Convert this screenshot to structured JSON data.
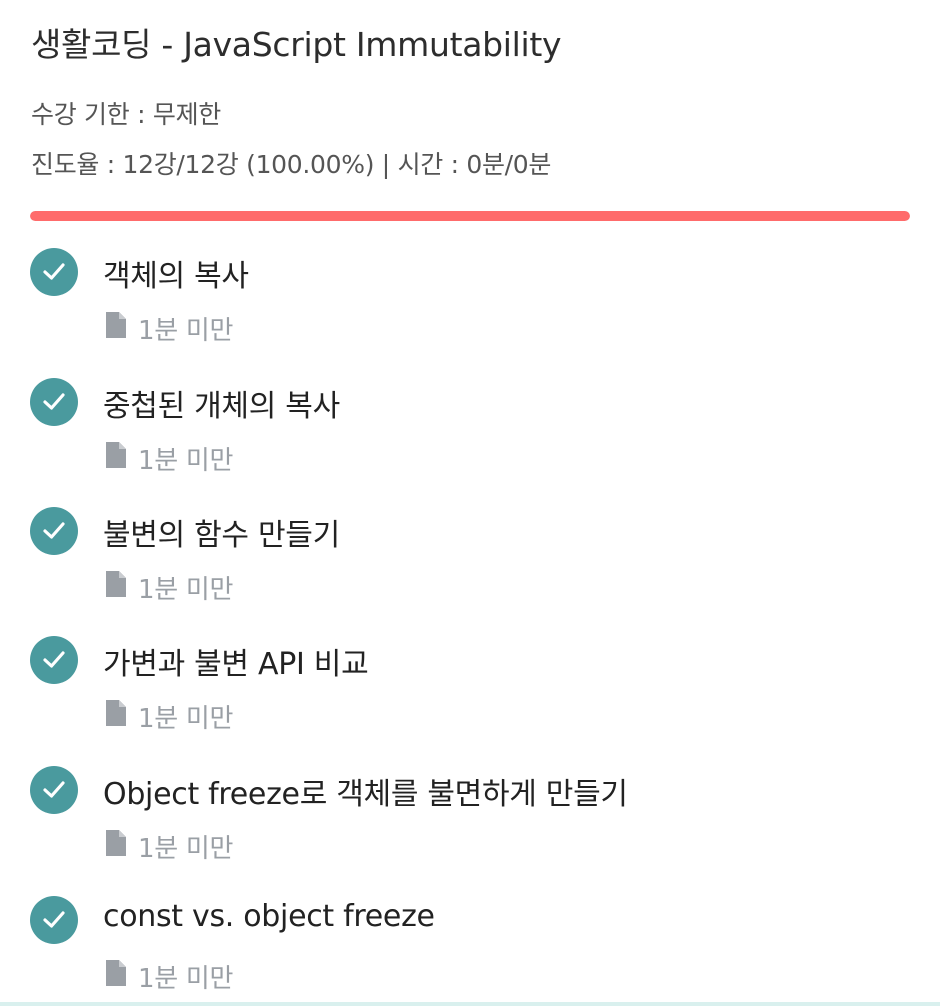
{
  "header": {
    "course_title": "생활코딩 - JavaScript Immutability",
    "limit_text": "수강 기한 : 무제한",
    "progress_text": "진도율 : 12강/12강 (100.00%) | 시간 : 0분/0분",
    "progress_fraction": 1.0,
    "progress_color": "#ff6b6b"
  },
  "lessons": [
    {
      "title": "객체의 복사",
      "duration": "1분 미만",
      "completed": true
    },
    {
      "title": "중첩된 개체의 복사",
      "duration": "1분 미만",
      "completed": true
    },
    {
      "title": "불변의 함수 만들기",
      "duration": "1분 미만",
      "completed": true
    },
    {
      "title": "가변과 불변 API 비교",
      "duration": "1분 미만",
      "completed": true
    },
    {
      "title": "Object freeze로 객체를 불면하게 만들기",
      "duration": "1분 미만",
      "completed": true
    },
    {
      "title": "const vs. object freeze",
      "duration": "1분 미만",
      "completed": true
    }
  ],
  "icons": {
    "completed": "check-circle-icon",
    "lesson_type": "document-icon"
  },
  "colors": {
    "check_circle": "#4a9a9e",
    "duration_text": "#9a9fa5"
  }
}
